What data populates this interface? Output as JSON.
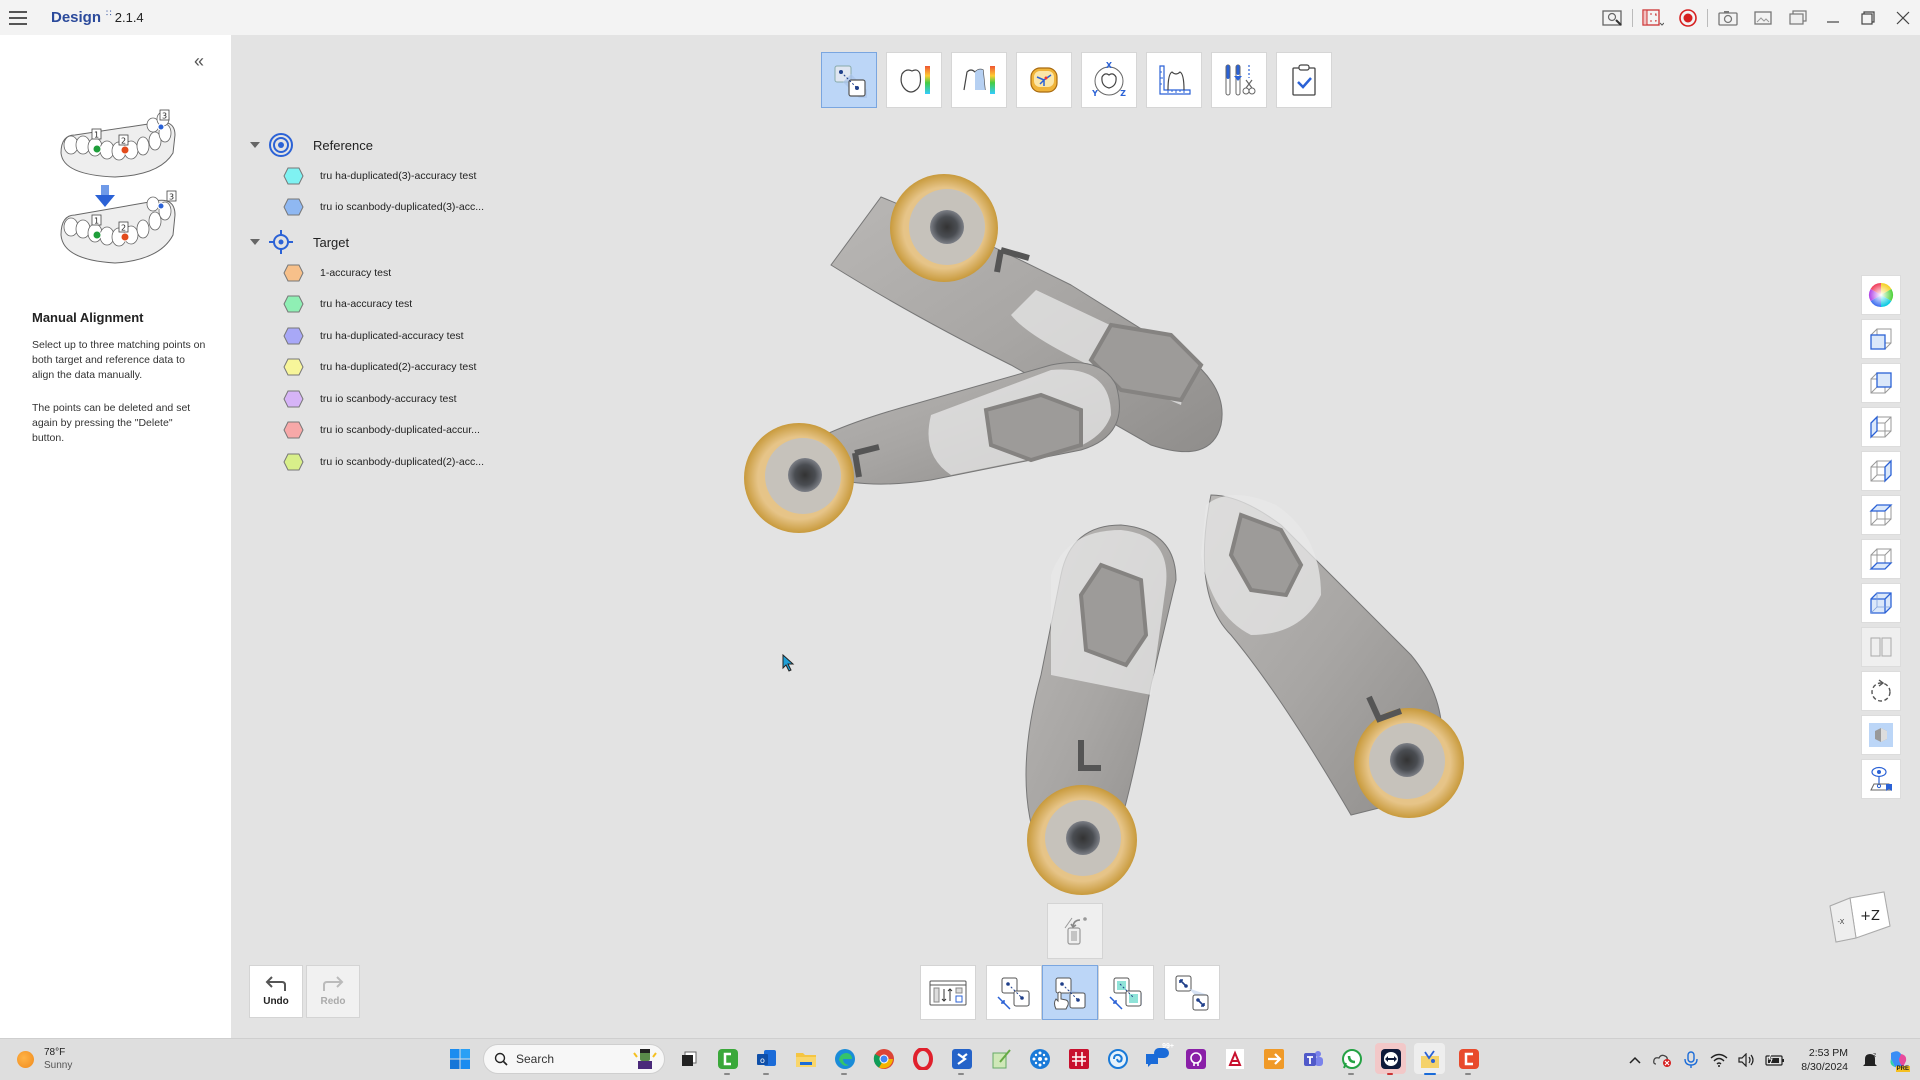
{
  "app": {
    "title": "Design",
    "badge": "∷",
    "version": "2.1.4"
  },
  "titlebar_controls": [
    {
      "name": "feedback-icon"
    },
    {
      "name": "screen-capture-region-icon"
    },
    {
      "name": "record-icon"
    },
    {
      "name": "camera-icon"
    },
    {
      "name": "screenshot-icon"
    },
    {
      "name": "gallery-icon"
    },
    {
      "name": "minimize-icon"
    },
    {
      "name": "restore-icon"
    },
    {
      "name": "close-icon"
    }
  ],
  "left_panel": {
    "collapse_label": "«",
    "illustration_labels": [
      "1",
      "2",
      "3"
    ],
    "title": "Manual Alignment",
    "description": "Select up to three matching points on both target and reference data to align the data manually.",
    "description2": "The points can be deleted and set again by pressing the \"Delete\" button."
  },
  "tree": {
    "reference": {
      "label": "Reference",
      "items": [
        {
          "label": "tru ha-duplicated(3)-accuracy test",
          "color": "#7ff2f2"
        },
        {
          "label": "tru io scanbody-duplicated(3)-acc...",
          "color": "#8fb8f2"
        }
      ]
    },
    "target": {
      "label": "Target",
      "items": [
        {
          "label": "1-accuracy test",
          "color": "#f7c08a"
        },
        {
          "label": "tru ha-accuracy test",
          "color": "#8fefb4"
        },
        {
          "label": "tru ha-duplicated-accuracy test",
          "color": "#a8a8f7"
        },
        {
          "label": "tru ha-duplicated(2)-accuracy test",
          "color": "#f7f59a"
        },
        {
          "label": "tru io scanbody-accuracy test",
          "color": "#d6b4f7"
        },
        {
          "label": "tru io scanbody-duplicated-accur...",
          "color": "#f7a8a8"
        },
        {
          "label": "tru io scanbody-duplicated(2)-acc...",
          "color": "#d8ef8a"
        }
      ]
    }
  },
  "top_toolbar": [
    {
      "name": "alignment-tool",
      "active": true
    },
    {
      "name": "deviation-map-tool",
      "active": false
    },
    {
      "name": "cross-section-deviation-tool",
      "active": false
    },
    {
      "name": "occlusion-map-tool",
      "active": false
    },
    {
      "name": "xyz-rotation-tool",
      "active": false
    },
    {
      "name": "measurement-tool",
      "active": false
    },
    {
      "name": "trim-tools",
      "active": false
    },
    {
      "name": "report-tool",
      "active": false
    }
  ],
  "right_toolbar": [
    {
      "name": "color-wheel"
    },
    {
      "name": "front-view"
    },
    {
      "name": "back-view"
    },
    {
      "name": "left-view"
    },
    {
      "name": "right-view"
    },
    {
      "name": "top-view"
    },
    {
      "name": "bottom-view"
    },
    {
      "name": "iso-view"
    },
    {
      "name": "split-view"
    },
    {
      "name": "reset-rotation"
    },
    {
      "name": "solid-view"
    },
    {
      "name": "view-point-bookmark"
    }
  ],
  "nav_cube": {
    "face": "+Z",
    "side": "-X"
  },
  "undo": {
    "label": "Undo"
  },
  "redo": {
    "label": "Redo"
  },
  "bottom_toolbar": [
    {
      "name": "data-list-layout",
      "active": false
    },
    {
      "name": "point-align-compress",
      "active": false
    },
    {
      "name": "point-align-manual",
      "active": true
    },
    {
      "name": "area-align",
      "active": false
    },
    {
      "name": "point-align-expand",
      "active": false
    }
  ],
  "taskbar": {
    "weather_temp": "78°F",
    "weather_cond": "Sunny",
    "search_placeholder": "Search",
    "time": "2:53 PM",
    "date": "8/30/2024",
    "badge_99": "99+",
    "copilot_badge": "PRE"
  }
}
